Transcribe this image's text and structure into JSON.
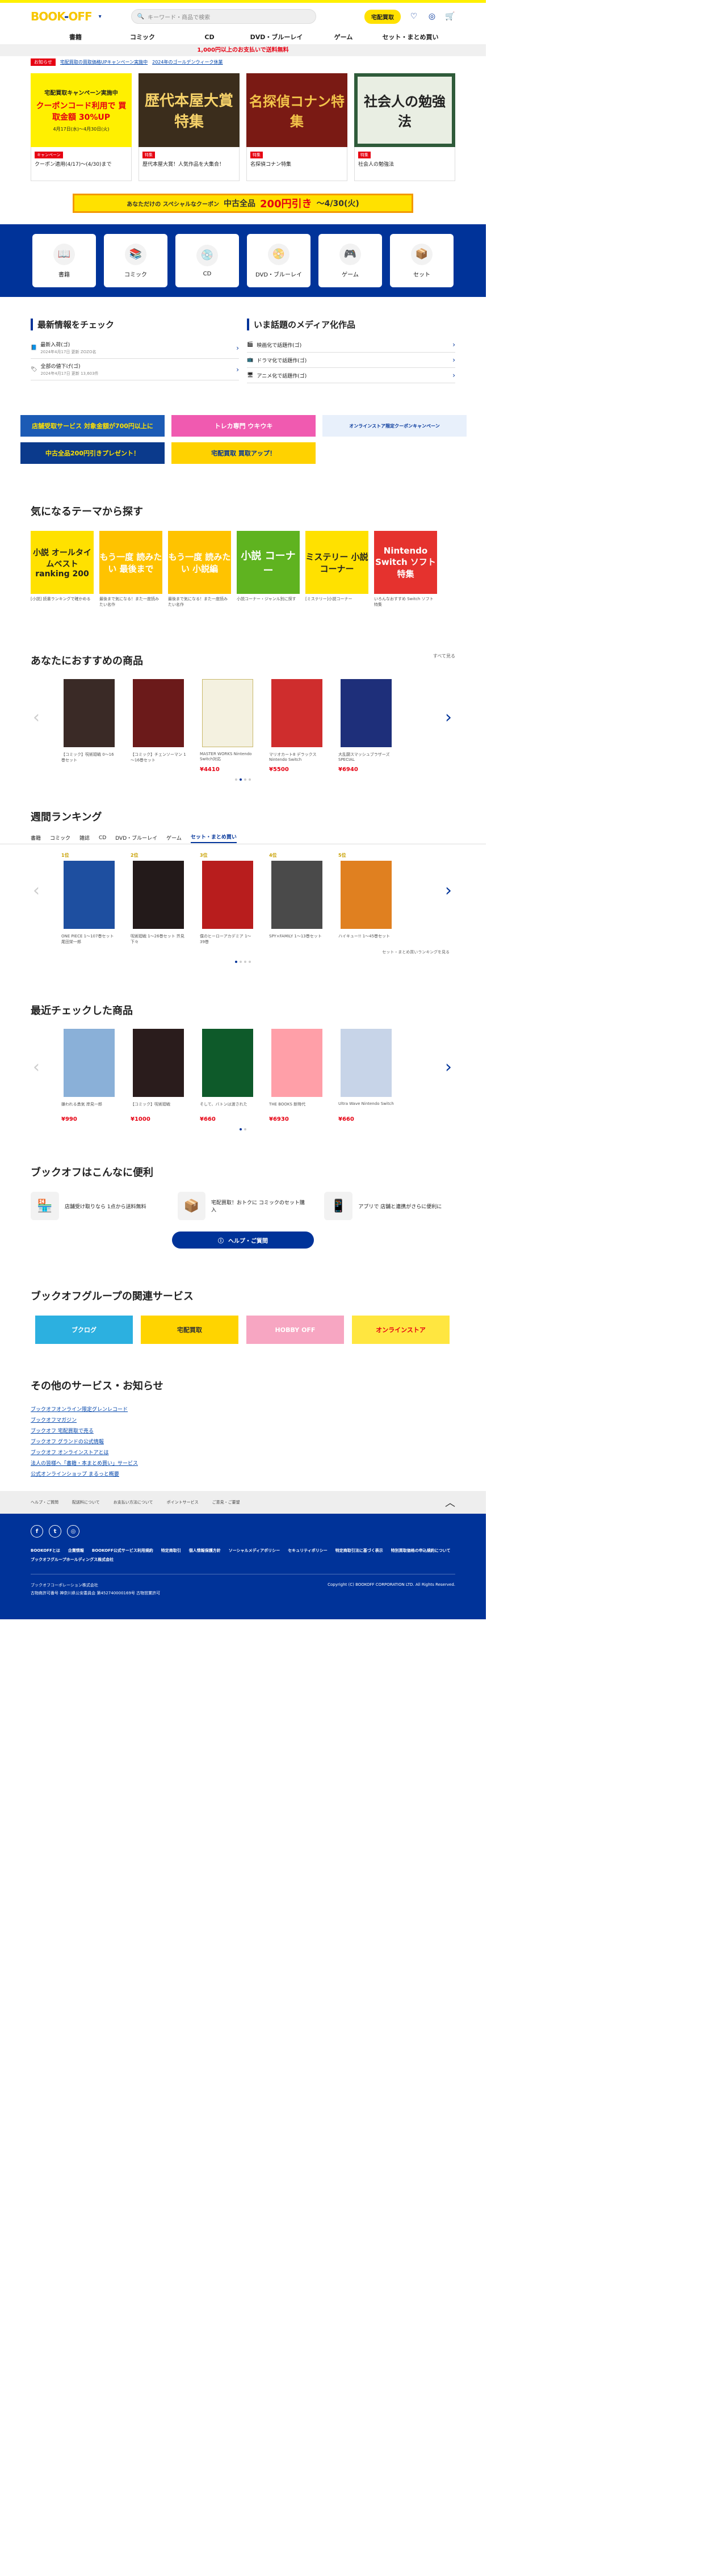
{
  "header": {
    "logo_text": "BOOK",
    "logo_accent": "OFF",
    "search_placeholder": "キーワード・商品で検索",
    "delivery_btn": "宅配買取",
    "heart": "♡",
    "user": "◎",
    "cart": "🛒"
  },
  "gnav": [
    "書籍",
    "コミック",
    "CD",
    "DVD・ブルーレイ",
    "ゲーム",
    "セット・まとめ買い"
  ],
  "notice": "1,000円以上のお支払いで送料無料",
  "news": {
    "tag": "お知らせ",
    "links": [
      "宅配買取の買取価格UPキャンペーン実施中",
      "2024年のゴールデンウィーク休業"
    ]
  },
  "banners": [
    {
      "title": "宅配買取キャンペーン実施中",
      "sub": "クーポンコード利用で 買取金額 30%UP",
      "period": "4月17日(水)～4月30日(火)",
      "tag": "キャンペーン",
      "caption": "クーポン適用(4/17)～(4/30)まで"
    },
    {
      "title": "歴代本屋大賞特集",
      "tag": "特集",
      "caption": "歴代本屋大賞！人気作品を大集合！"
    },
    {
      "title": "名探偵コナン特集",
      "tag": "特集",
      "caption": "名探偵コナン特集"
    },
    {
      "title": "社会人の勉強法",
      "tag": "特集",
      "caption": "社会人の勉強法"
    }
  ],
  "coupon": {
    "pre": "あなただけの スペシャルなクーポン",
    "main": "中古全品",
    "amount": "200円引き",
    "period": "～4/30(火)"
  },
  "categories": [
    {
      "label": "書籍",
      "icon": "📖"
    },
    {
      "label": "コミック",
      "icon": "📚"
    },
    {
      "label": "CD",
      "icon": "💿"
    },
    {
      "label": "DVD・ブルーレイ",
      "icon": "📀"
    },
    {
      "label": "ゲーム",
      "icon": "🎮"
    },
    {
      "label": "セット",
      "icon": "📦"
    }
  ],
  "info": {
    "left_title": "最新情報をチェック",
    "left_rows": [
      {
        "text": "最新入荷(ゴ)",
        "sub": "2024年4月17日 更新 ZOZO名"
      },
      {
        "text": "全部の値下げ(ゴ)",
        "sub": "2024年4月17日 更新 13,603件"
      }
    ],
    "right_title": "いま話題のメディア化作品",
    "right_rows": [
      {
        "text": "映画化で話題作(ゴ)"
      },
      {
        "text": "ドラマ化で話題作(ゴ)"
      },
      {
        "text": "アニメ化で話題作(ゴ)"
      }
    ]
  },
  "ads": [
    {
      "text": "店舗受取サービス 対象金額が700円以上に",
      "bg": "#1c5bb5",
      "fg": "#ffe100"
    },
    {
      "text": "トレカ専門 ウキウキ",
      "bg": "#f05ab0",
      "fg": "#ffffff"
    },
    {
      "text": "オンラインストア限定クーポンキャンペーン",
      "bg": "#e8f0fb",
      "fg": "#003399"
    },
    {
      "text": "中古全品200円引きプレゼント！",
      "bg": "#0b3a8c",
      "fg": "#ffe100"
    },
    {
      "text": "宅配買取 買取アップ！",
      "bg": "#ffd200",
      "fg": "#003399"
    }
  ],
  "themes": {
    "title": "気になるテーマから探す",
    "items": [
      {
        "label": "小説 オールタイムベスト ranking 200",
        "bg": "#ffe100",
        "fg": "#222",
        "cap": "[小説] 読書ランキングで確かめる"
      },
      {
        "label": "もう一度 読みたい 最後まで",
        "bg": "#ffc300",
        "fg": "#fff",
        "cap": "最後まで気になる！また一度読みたい名作"
      },
      {
        "label": "もう一度 読みたい 小説編",
        "bg": "#ffc300",
        "fg": "#fff",
        "cap": "最後まで気になる！また一度読みたい名作"
      },
      {
        "label": "小説 コーナー",
        "bg": "#5fb320",
        "fg": "#fff",
        "cap": "小説コーナー・ジャンル別に探す"
      },
      {
        "label": "ミステリー 小説コーナー",
        "bg": "#ffe100",
        "fg": "#222",
        "cap": "[ミステリー]小説コーナー"
      },
      {
        "label": "Nintendo Switch ソフト特集",
        "bg": "#e5322e",
        "fg": "#fff",
        "cap": "いろんなおすすめ Switch ソフト特集"
      }
    ]
  },
  "recommend": {
    "title": "あなたにおすすめの商品",
    "more": "すべて見る",
    "items": [
      {
        "name": "【コミック】呪術廻戦 0～16巻セット",
        "price": "",
        "bg": "#3a2a26"
      },
      {
        "name": "【コミック】チェンソーマン 1～16巻セット",
        "price": "",
        "bg": "#6b1a1a"
      },
      {
        "name": "MASTER WORKS Nintendo Switch対応",
        "price": "¥4410",
        "bg": "#f4f1e0"
      },
      {
        "name": "マリオカート8 デラックス Nintendo Switch",
        "price": "¥5500",
        "bg": "#cf2d2d"
      },
      {
        "name": "大乱闘スマッシュブラザーズ SPECIAL",
        "price": "¥6940",
        "bg": "#1e2f7a"
      }
    ]
  },
  "ranking": {
    "title": "週間ランキング",
    "tabs": [
      "書籍",
      "コミック",
      "雑誌",
      "CD",
      "DVD・ブルーレイ",
      "ゲーム",
      "セット・まとめ買い"
    ],
    "more": "セット・まとめ買いランキングを見る",
    "items": [
      {
        "rank": "1位",
        "name": "ONE PIECE 1～107巻セット 尾田栄一郎",
        "bg": "#1e4fa0"
      },
      {
        "rank": "2位",
        "name": "呪術廻戦 1～26巻セット 芥見下々",
        "bg": "#231a1a"
      },
      {
        "rank": "3位",
        "name": "僕のヒーローアカデミア 1～39巻",
        "bg": "#b81d1d"
      },
      {
        "rank": "4位",
        "name": "SPY×FAMILY 1～13巻セット",
        "bg": "#4a4a4a"
      },
      {
        "rank": "5位",
        "name": "ハイキュー!! 1～45巻セット",
        "bg": "#e08020"
      }
    ]
  },
  "history": {
    "title": "最近チェックした商品",
    "items": [
      {
        "name": "嫌われる勇気 岸見一郎",
        "price": "¥990",
        "bg": "#8ab0d8"
      },
      {
        "name": "【コミック】呪術廻戦",
        "price": "¥1000",
        "bg": "#2a1c1c"
      },
      {
        "name": "そして、バトンは渡された",
        "price": "¥660",
        "bg": "#0e5a2a"
      },
      {
        "name": "THE BOOKS 新時代",
        "price": "¥6930",
        "bg": "#ff9fa8"
      },
      {
        "name": "Ultra Wave Nintendo Switch",
        "price": "¥660",
        "bg": "#c7d4e8"
      }
    ]
  },
  "convenience": {
    "title": "ブックオフはこんなに便利",
    "items": [
      {
        "text": "店舗受け取りなら 1点から送料無料",
        "icon": "🏪"
      },
      {
        "text": "宅配買取！おトクに コミックのセット購入",
        "icon": "📦"
      },
      {
        "text": "アプリで 店舗と連携がさらに便利に",
        "icon": "📱"
      }
    ],
    "help_btn": "ヘルプ・ご質問"
  },
  "group": {
    "title": "ブックオフグループの関連サービス",
    "items": [
      {
        "text": "ブクログ",
        "bg": "#2cb0e0"
      },
      {
        "text": "宅配買取",
        "bg": "#ffd400"
      },
      {
        "text": "HOBBY OFF",
        "bg": "#f7a6c2"
      },
      {
        "text": "オンラインストア",
        "bg": "#ffe640"
      }
    ]
  },
  "other": {
    "title": "その他のサービス・お知らせ",
    "links": [
      "ブックオフオンライン限定グレンレコード",
      "ブックオフマガジン",
      "ブックオフ 宅配買取で売る",
      "ブックオフ グランドの公式情報",
      "ブックオフ オンラインストアとは",
      "法人の皆様へ「書籍・本まとめ買い」サービス",
      "公式オンラインショップ まるっと概要"
    ]
  },
  "footnav": [
    "ヘルプ・ご質問",
    "配送料について",
    "お支払い方法について",
    "ポイントサービス",
    "ご意見・ご要望"
  ],
  "footer": {
    "socials": [
      "f",
      "t",
      "◎"
    ],
    "links": [
      "BOOKOFFとは",
      "企業情報",
      "BOOKOFF公式サービス利用規約",
      "特定商取引",
      "個人情報保護方針",
      "ソーシャルメディアポリシー",
      "セキュリティポリシー",
      "特定商取引法に基づく表示",
      "特別買取価格の申込規約について",
      "ブックオフグループホールディングス株式会社"
    ],
    "company": "ブックオフコーポレーション株式会社",
    "address": "古物商許可番号 神奈川県公安委員会 第452740000169号 古物営業許可",
    "copyright": "Copyright (C) BOOKOFF CORPORATION LTD. All Rights Reserved."
  }
}
